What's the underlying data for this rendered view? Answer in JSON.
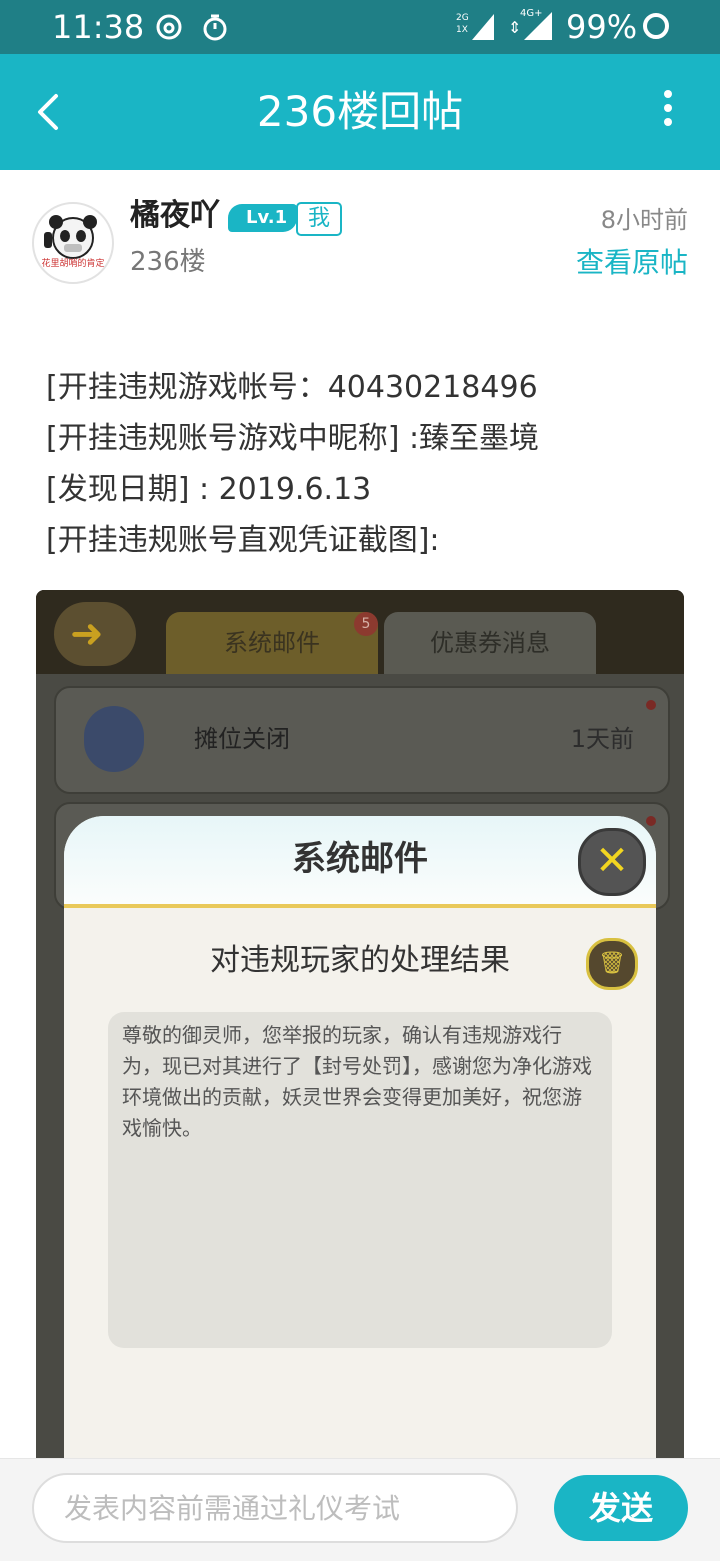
{
  "status_bar": {
    "time": "11:38",
    "network_top": "2G",
    "network_bottom": "1X",
    "lte_label": "4G+",
    "battery": "99%"
  },
  "title_bar": {
    "title": "236楼回帖",
    "back_icon": "back-arrow-icon",
    "more_icon": "more-vertical-icon"
  },
  "post": {
    "username": "橘夜吖",
    "level": "Lv.1",
    "me_badge": "我",
    "floor": "236楼",
    "time_ago": "8小时前",
    "view_original": "查看原帖",
    "avatar_caption": "花里胡哨的肯定",
    "lines": [
      "[开挂违规游戏帐号：40430218496",
      "[开挂违规账号游戏中昵称] :臻至墨境",
      "[发现日期] : 2019.6.13",
      "[开挂违规账号直观凭证截图]:"
    ]
  },
  "screenshot": {
    "tab_system_mail": "系统邮件",
    "tab_badge": "5",
    "tab_coupons": "优惠券消息",
    "row_title": "摊位关闭",
    "row_time": "1天前",
    "dialog_title": "系统邮件",
    "dialog_subtitle": "对违规玩家的处理结果",
    "dialog_message": "尊敬的御灵师，您举报的玩家，确认有违规游戏行为，现已对其进行了【封号处罚】，感谢您为净化游戏环境做出的贡献，妖灵世界会变得更加美好，祝您游戏愉快。"
  },
  "reply_bar": {
    "placeholder": "发表内容前需通过礼仪考试",
    "send_label": "发送"
  },
  "colors": {
    "accent": "#1ab5c5",
    "status_bar": "#1f7f86"
  }
}
